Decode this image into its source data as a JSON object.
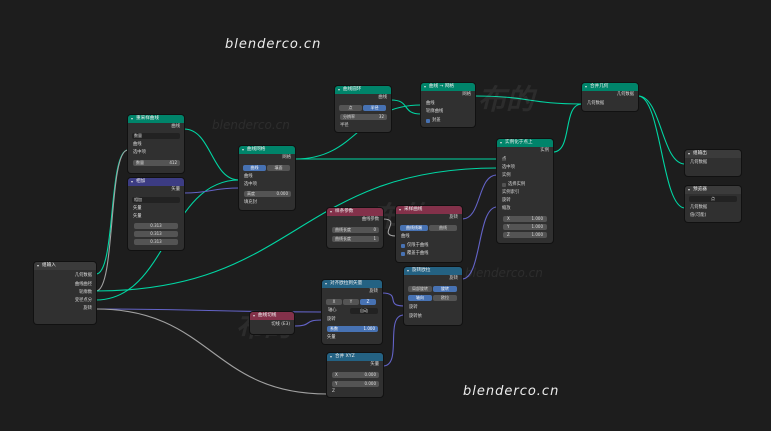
{
  "watermarks": {
    "top": "blenderco.cn",
    "bottom": "blenderco.cn"
  },
  "faint_watermarks": {
    "a": "布的",
    "b": "blenderco.cn",
    "c": "布的",
    "d": "blenderco.cn",
    "e": "布的",
    "f": "blenderco.cn",
    "g": "布的"
  },
  "colors": {
    "geometry": "#00d6a3",
    "vector": "#6363c7",
    "float": "#a1a1a1",
    "int": "#598c5c",
    "header_geometry": "#00846a",
    "header_input": "#83314a",
    "header_vector": "#3c3c83",
    "header_converter": "#246283"
  },
  "nodes": {
    "group_input": {
      "title": "组输入",
      "outputs": [
        "几何数据",
        "曲线曲径",
        "轮廓数",
        "变径点分",
        "旋转",
        ""
      ]
    },
    "curve_resample": {
      "title": "重采样曲线",
      "out": "曲线",
      "mode": "数量",
      "in1": "曲线",
      "in2": "选中项",
      "count_label": "数量",
      "count_value": "412"
    },
    "vector_math": {
      "title": "相加",
      "out": "矢量",
      "mode": "相加",
      "in1": "矢量",
      "in2": "矢量",
      "vals": [
        "0.313",
        "0.313",
        "0.313"
      ]
    },
    "curve_to_mesh": {
      "title": "曲线网格",
      "out": "网格",
      "opt_a": "曲线",
      "opt_b": "填面",
      "in1": "曲线",
      "in2": "选中项",
      "field_label": "高度",
      "field_value": "0.000",
      "in3": "填充封"
    },
    "curve_circle": {
      "title": "曲线圆环",
      "opt_a": "点",
      "opt_b": "半径",
      "out": "曲线",
      "res_label": "分辨率",
      "res_value": "32",
      "in1": "半径"
    },
    "realize_instances": {
      "title": "曲线 → 网格",
      "out": "网格",
      "in1": "曲线",
      "in2": "轮廓曲线",
      "in3": "封盖"
    },
    "join_geometry": {
      "title": "合并几何",
      "out": "几何数据",
      "in1": "几何数据"
    },
    "group_output": {
      "title": "组输出",
      "in1": "几何数据",
      "in2": ""
    },
    "viewer": {
      "title": "预览器",
      "mode": "点",
      "in1": "几何数据",
      "in2": "值(可能)"
    },
    "instance_on_points": {
      "title": "实例化于点上",
      "out": "实例",
      "in1": "点",
      "in2": "选中项",
      "in3": "实例",
      "in4": "选择实例",
      "in5": "实例索引",
      "in6": "旋转",
      "in7": "缩放",
      "scale": [
        {
          "axis": "X",
          "value": "1.000"
        },
        {
          "axis": "Y",
          "value": "1.000"
        },
        {
          "axis": "Z",
          "value": "1.000"
        }
      ]
    },
    "float_curve": {
      "title": "样条参数",
      "out1": "曲线参数",
      "out2": "长度",
      "in1": "曲线长度",
      "in1_value": "0",
      "in2": "曲线长度",
      "in2_value": "1"
    },
    "compare": {
      "title": "采样曲线",
      "out": "旋转",
      "opt_a": "曲线线端",
      "opt_b": "曲线",
      "in1": "曲线",
      "chk1": "仅限于曲线",
      "chk2": "覆盖于曲线"
    },
    "align_euler": {
      "title": "对齐欧拉到矢量",
      "out": "旋转",
      "axes": [
        "X",
        "Y",
        "Z"
      ],
      "pivot_label": "轴心",
      "pivot_value": "自动",
      "in1": "旋转",
      "factor_label": "系数",
      "factor_value": "1.000",
      "in2": "矢量"
    },
    "rotate_euler": {
      "title": "旋转欧拉",
      "out": "旋转",
      "opt_a": "局部旋转",
      "opt_b": "旋转",
      "opt_c": "轴向",
      "opt_d": "欧拉",
      "in1": "旋转",
      "in2": "旋转依"
    },
    "spline_param": {
      "title": "曲线切线",
      "out": "切线 (E3)",
      "in1": "旋转",
      "in2": "系数",
      "factor_value": "1.000",
      "in3": "矢量"
    },
    "combine_xyz": {
      "title": "合并 XYZ",
      "out": "矢量",
      "in_x": "X",
      "x_value": "0.000",
      "in_y": "Y",
      "y_value": "0.000",
      "in_z": "Z"
    }
  }
}
